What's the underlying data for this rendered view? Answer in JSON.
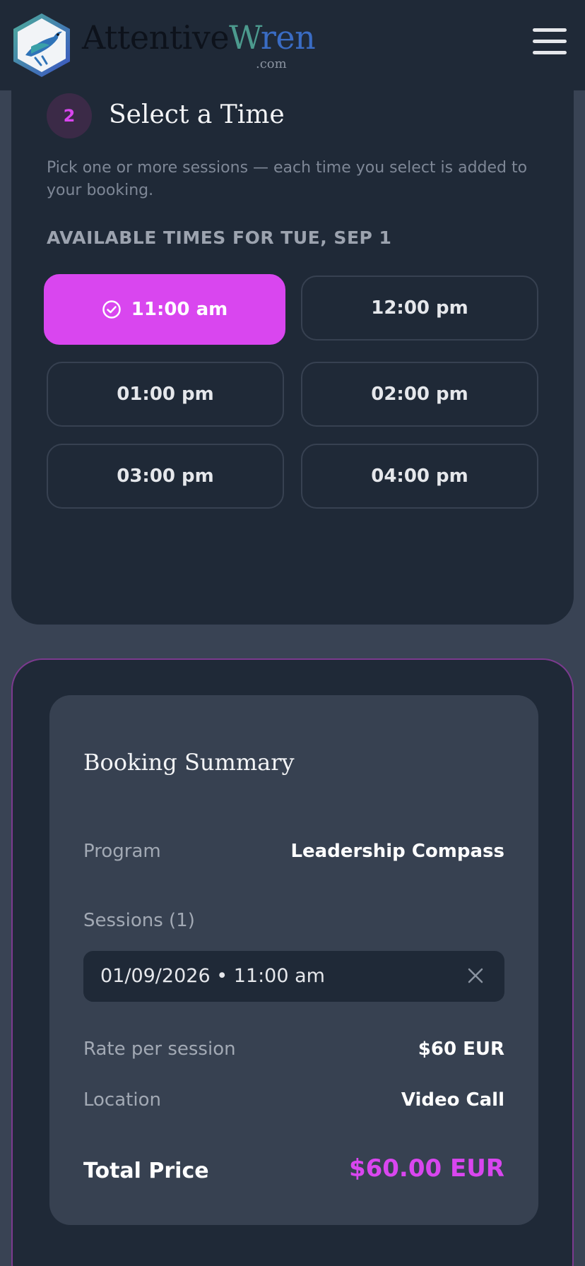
{
  "brand": {
    "name_part1": "Attentive",
    "name_part2_w": "W",
    "name_part2_rest": "ren",
    "suffix": ".com",
    "logo_icon": "bird-hexagon-icon",
    "colors": {
      "dark": "#0d121b",
      "teal": "#4c9a8e",
      "blue": "#3a6cc4"
    }
  },
  "header": {
    "menu_icon": "hamburger-menu-icon"
  },
  "time_step": {
    "number": "2",
    "title": "Select a Time",
    "description": "Pick one or more sessions — each time you select is added to your booking.",
    "available_label": "AVAILABLE TIMES FOR TUE, SEP 1",
    "slots": [
      {
        "label": "11:00 am",
        "selected": true
      },
      {
        "label": "12:00 pm",
        "selected": false
      },
      {
        "label": "01:00 pm",
        "selected": false
      },
      {
        "label": "02:00 pm",
        "selected": false
      },
      {
        "label": "03:00 pm",
        "selected": false
      },
      {
        "label": "04:00 pm",
        "selected": false
      }
    ]
  },
  "summary": {
    "title": "Booking Summary",
    "program_label": "Program",
    "program_value": "Leadership Compass",
    "sessions_label": "Sessions (1)",
    "session_item": "01/09/2026 • 11:00 am",
    "rate_label": "Rate per session",
    "rate_value": "$60 EUR",
    "location_label": "Location",
    "location_value": "Video Call",
    "total_label": "Total Price",
    "total_value": "$60.00 EUR"
  },
  "colors": {
    "accent": "#d946ef",
    "card_bg": "#1f2937",
    "page_bg": "#394354"
  }
}
